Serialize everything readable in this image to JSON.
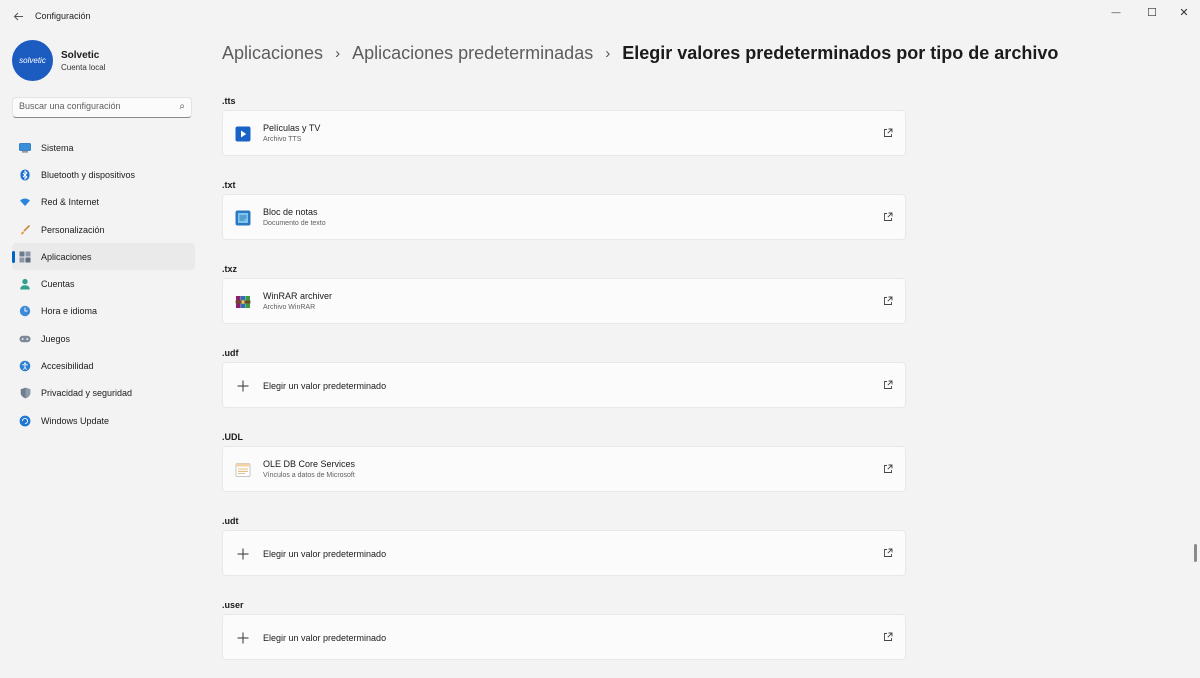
{
  "window": {
    "title": "Configuración",
    "minimize": "—",
    "maximize": "☐",
    "close": "✕"
  },
  "profile": {
    "name": "Solvetic",
    "subtitle": "Cuenta local",
    "avatar_text": "solvetic"
  },
  "search": {
    "placeholder": "Buscar una configuración"
  },
  "nav": [
    {
      "label": "Sistema",
      "icon": "monitor-icon",
      "active": false
    },
    {
      "label": "Bluetooth y dispositivos",
      "icon": "bluetooth-icon",
      "active": false
    },
    {
      "label": "Red & Internet",
      "icon": "wifi-icon",
      "active": false
    },
    {
      "label": "Personalización",
      "icon": "brush-icon",
      "active": false
    },
    {
      "label": "Aplicaciones",
      "icon": "apps-icon",
      "active": true
    },
    {
      "label": "Cuentas",
      "icon": "person-icon",
      "active": false
    },
    {
      "label": "Hora e idioma",
      "icon": "globe-clock-icon",
      "active": false
    },
    {
      "label": "Juegos",
      "icon": "gamepad-icon",
      "active": false
    },
    {
      "label": "Accesibilidad",
      "icon": "accessibility-icon",
      "active": false
    },
    {
      "label": "Privacidad y seguridad",
      "icon": "shield-icon",
      "active": false
    },
    {
      "label": "Windows Update",
      "icon": "update-icon",
      "active": false
    }
  ],
  "breadcrumb": [
    "Aplicaciones",
    "Aplicaciones predeterminadas",
    "Elegir valores predeterminados por tipo de archivo"
  ],
  "file_types": [
    {
      "ext": ".tts",
      "app": "Películas y TV",
      "desc": "Archivo TTS",
      "icon": "movies-tv-icon"
    },
    {
      "ext": ".txt",
      "app": "Bloc de notas",
      "desc": "Documento de texto",
      "icon": "notepad-icon"
    },
    {
      "ext": ".txz",
      "app": "WinRAR archiver",
      "desc": "Archivo WinRAR",
      "icon": "winrar-icon"
    },
    {
      "ext": ".udf",
      "app": "Elegir un valor predeterminado",
      "desc": "",
      "icon": "plus-icon"
    },
    {
      "ext": ".UDL",
      "app": "OLE DB Core Services",
      "desc": "Vínculos a datos de Microsoft",
      "icon": "udl-icon"
    },
    {
      "ext": ".udt",
      "app": "Elegir un valor predeterminado",
      "desc": "",
      "icon": "plus-icon"
    },
    {
      "ext": ".user",
      "app": "Elegir un valor predeterminado",
      "desc": "",
      "icon": "plus-icon"
    }
  ],
  "colors": {
    "accent": "#0067c0",
    "background": "#f3f3f3",
    "card": "#fbfbfb"
  }
}
